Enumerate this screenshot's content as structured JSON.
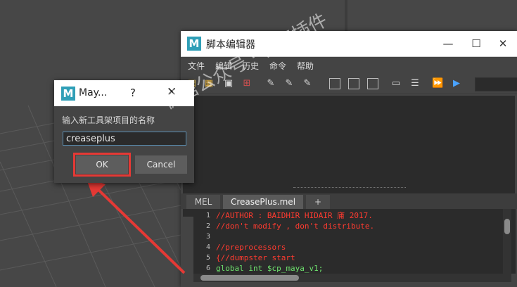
{
  "script_editor": {
    "title": "脚本编辑器",
    "logo": "M",
    "menu": [
      "文件",
      "编辑",
      "历史",
      "命令",
      "帮助"
    ],
    "tabs": [
      "MEL",
      "CreasePlus.mel",
      "+"
    ],
    "code_lines": [
      {
        "num": "1",
        "text": "//AUTHOR : BAIDHIR HIDAIR 庯 2017.",
        "color": "#ff3b30"
      },
      {
        "num": "2",
        "text": "//don't modify , don't distribute.",
        "color": "#ff3b30"
      },
      {
        "num": "3",
        "text": "",
        "color": "#ff3b30"
      },
      {
        "num": "4",
        "text": "//preprocessors",
        "color": "#ff3b30"
      },
      {
        "num": "5",
        "text": "{//dumpster start",
        "color": "#ff3b30"
      },
      {
        "num": "6",
        "text": "global int $cp_maya_v1;",
        "color": "#6ee36e"
      }
    ]
  },
  "dialog": {
    "title": "May...",
    "logo": "M",
    "help": "?",
    "close": "✕",
    "label": "输入新工具架项目的名称",
    "input_value": "creaseplus",
    "ok_label": "OK",
    "cancel_label": "Cancel"
  },
  "watermark": "微信公众号 · 管家插件",
  "colors": {
    "highlight": "#e53935",
    "maya_blue": "#2f9fb7"
  }
}
